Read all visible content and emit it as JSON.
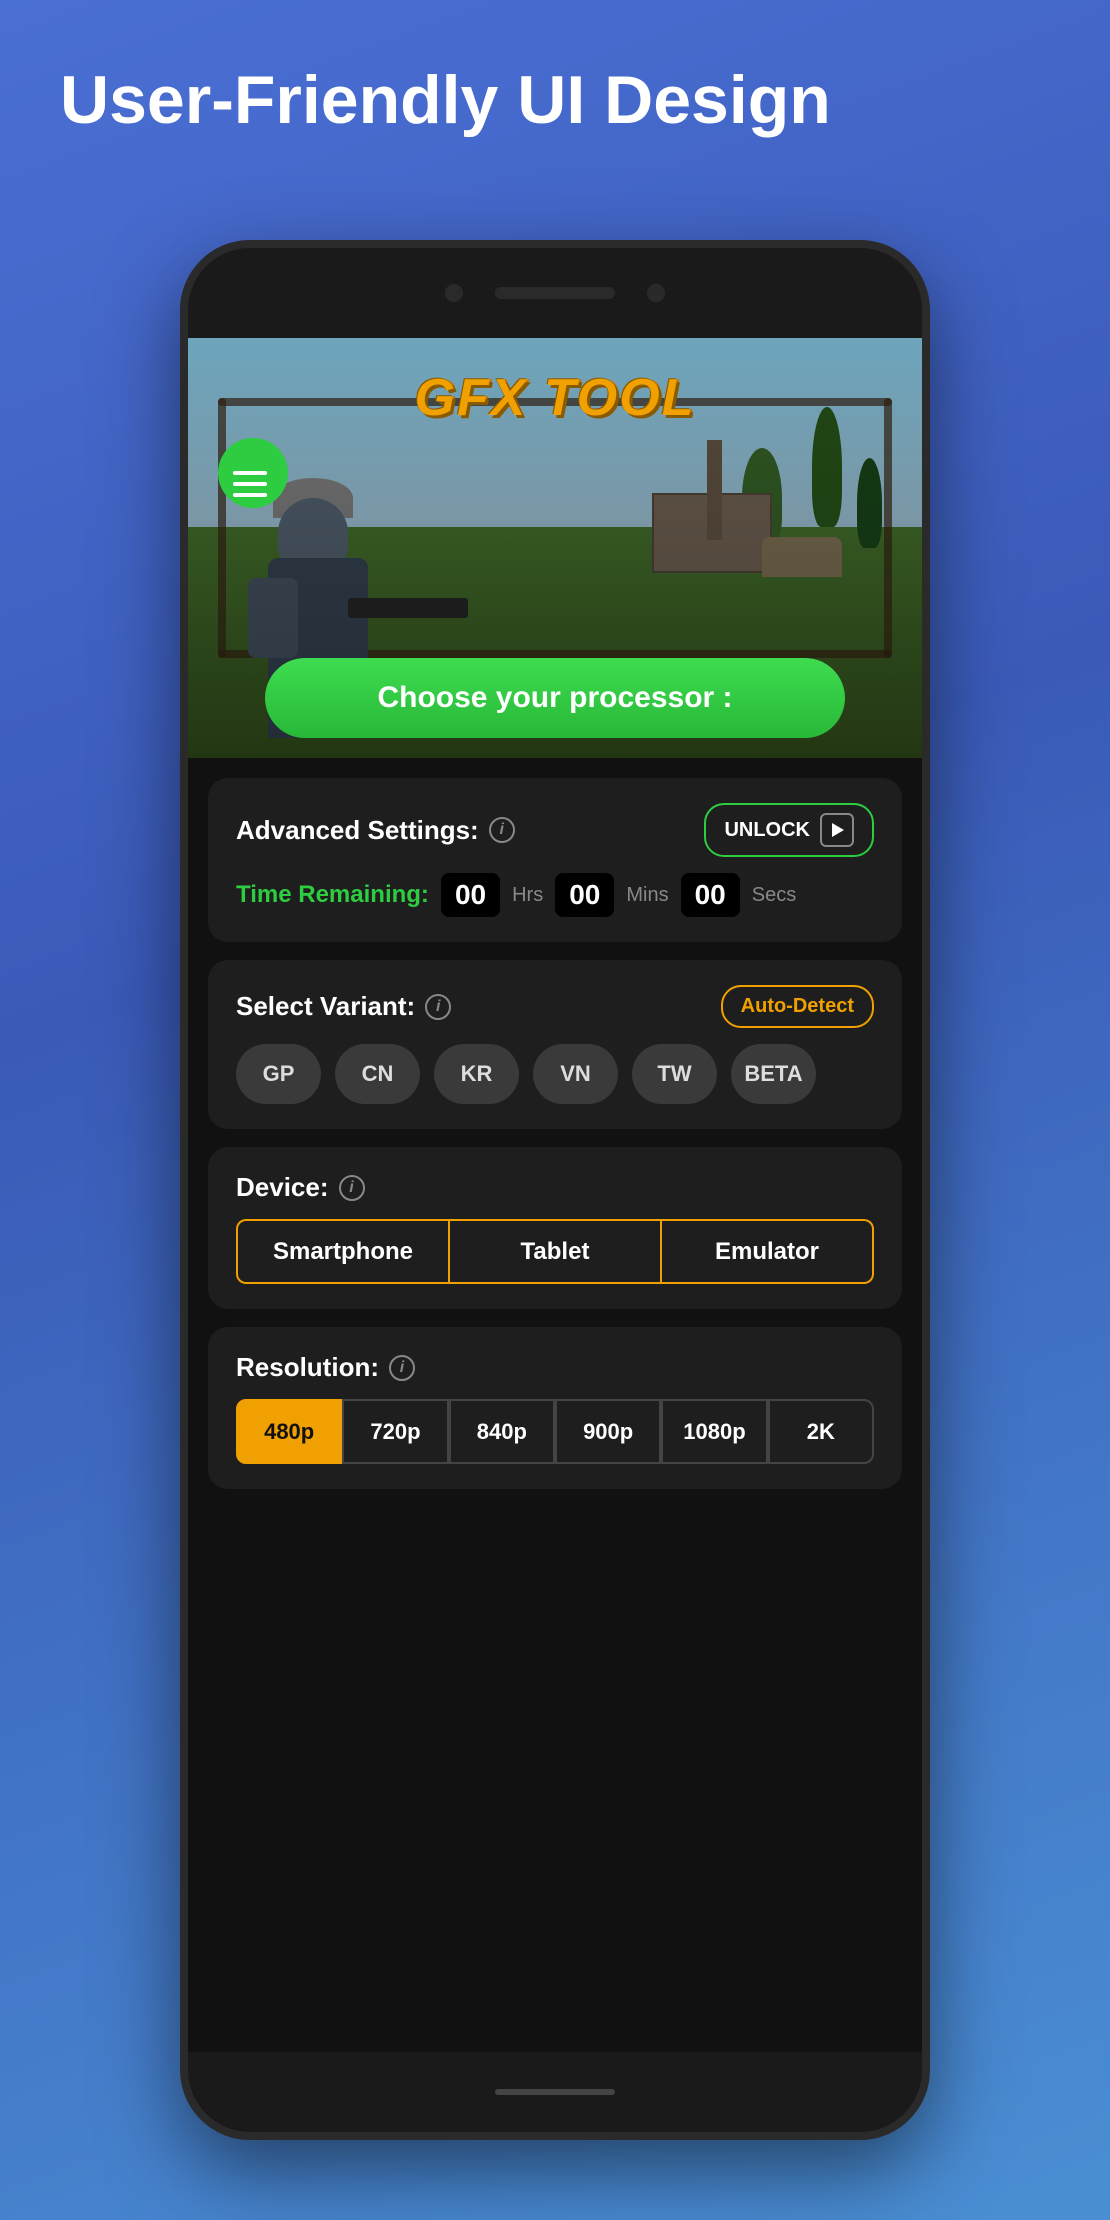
{
  "page": {
    "title": "User-Friendly UI Design",
    "background_color": "#4a6fd4"
  },
  "app": {
    "name": "GFX TOOL",
    "banner_button": "Choose your processor :"
  },
  "menu_button": {
    "icon": "hamburger-icon"
  },
  "advanced_settings": {
    "label": "Advanced Settings:",
    "info_icon": "info-icon",
    "unlock_button": "UNLOCK",
    "time_remaining_label": "Time Remaining:",
    "hours": "00",
    "hours_unit": "Hrs",
    "minutes": "00",
    "minutes_unit": "Mins",
    "seconds": "00",
    "seconds_unit": "Secs"
  },
  "select_variant": {
    "label": "Select Variant:",
    "info_icon": "info-icon",
    "auto_detect_label": "Auto-Detect",
    "variants": [
      "GP",
      "CN",
      "KR",
      "VN",
      "TW",
      "BETA"
    ]
  },
  "device": {
    "label": "Device:",
    "info_icon": "info-icon",
    "options": [
      "Smartphone",
      "Tablet",
      "Emulator"
    ],
    "selected": "Smartphone"
  },
  "resolution": {
    "label": "Resolution:",
    "info_icon": "info-icon",
    "options": [
      "480p",
      "720p",
      "840p",
      "900p",
      "1080p",
      "2K"
    ],
    "selected": "480p"
  },
  "colors": {
    "green": "#2ecc40",
    "gold": "#f0a000",
    "white": "#ffffff",
    "dark_bg": "#111111",
    "card_bg": "#1e1e1e"
  }
}
